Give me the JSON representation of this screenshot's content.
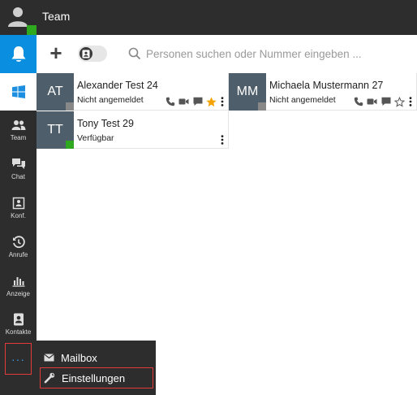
{
  "header": {
    "title": "Team"
  },
  "sidebar": {
    "items": [
      {
        "label": "Team",
        "icon": "team-icon"
      },
      {
        "label": "Chat",
        "icon": "chat-icon"
      },
      {
        "label": "Konf.",
        "icon": "conference-icon"
      },
      {
        "label": "Anrufe",
        "icon": "history-icon"
      },
      {
        "label": "Anzeige",
        "icon": "chart-icon"
      },
      {
        "label": "Kontakte",
        "icon": "contacts-icon"
      }
    ],
    "more_label": "···"
  },
  "toolbar": {
    "add_label": "+",
    "search_placeholder": "Personen suchen oder Nummer eingeben ..."
  },
  "contacts": [
    {
      "initials": "AT",
      "name": "Alexander Test 24",
      "status": "Nicht angemeldet",
      "presence": "offline",
      "favorite": true
    },
    {
      "initials": "MM",
      "name": "Michaela Mustermann 27",
      "status": "Nicht angemeldet",
      "presence": "offline",
      "favorite": false
    },
    {
      "initials": "TT",
      "name": "Tony Test 29",
      "status": "Verfügbar",
      "presence": "available",
      "favorite": false
    }
  ],
  "menu": {
    "items": [
      {
        "label": "Mailbox",
        "icon": "mail-icon"
      },
      {
        "label": "Einstellungen",
        "icon": "wrench-icon"
      }
    ]
  },
  "colors": {
    "accent": "#0a8fe0",
    "available": "#2ea81f",
    "offline": "#888888",
    "favorite": "#f5a300",
    "highlight": "#e03a3a"
  }
}
